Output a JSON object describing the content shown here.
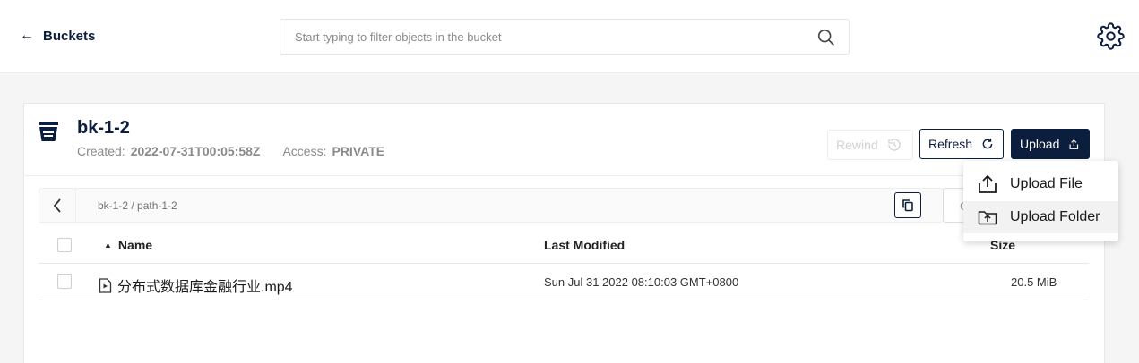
{
  "topbar": {
    "back_label": "Buckets",
    "search_placeholder": "Start typing to filter objects in the bucket"
  },
  "bucket": {
    "name": "bk-1-2",
    "created_label": "Created:",
    "created_value": "2022-07-31T00:05:58Z",
    "access_label": "Access:",
    "access_value": "PRIVATE"
  },
  "actions": {
    "rewind_label": "Rewind",
    "refresh_label": "Refresh",
    "upload_label": "Upload"
  },
  "upload_menu": {
    "items": [
      {
        "label": "Upload File",
        "icon": "upload-file-icon"
      },
      {
        "label": "Upload Folder",
        "icon": "upload-folder-icon"
      }
    ]
  },
  "breadcrumb": {
    "path": "bk-1-2 / path-1-2",
    "partial_button_label": "C"
  },
  "table": {
    "columns": {
      "name": "Name",
      "last_modified": "Last Modified",
      "size": "Size"
    },
    "sort": "ascending by name",
    "rows": [
      {
        "name": "分布式数据库金融行业.mp4",
        "last_modified": "Sun Jul 31 2022 08:10:03 GMT+0800",
        "size": "20.5 MiB"
      }
    ]
  },
  "colors": {
    "accent": "#0c1e3e",
    "background": "#f5f5f5"
  }
}
